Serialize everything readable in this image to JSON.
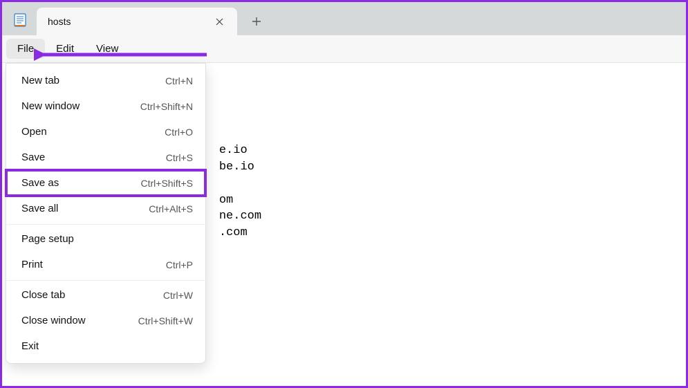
{
  "tab": {
    "title": "hosts"
  },
  "menubar": [
    "File",
    "Edit",
    "View"
  ],
  "dropdown": {
    "items": [
      {
        "label": "New tab",
        "shortcut": "Ctrl+N"
      },
      {
        "label": "New window",
        "shortcut": "Ctrl+Shift+N"
      },
      {
        "label": "Open",
        "shortcut": "Ctrl+O"
      },
      {
        "label": "Save",
        "shortcut": "Ctrl+S"
      },
      {
        "label": "Save as",
        "shortcut": "Ctrl+Shift+S"
      },
      {
        "label": "Save all",
        "shortcut": "Ctrl+Alt+S"
      },
      {
        "label": "Page setup",
        "shortcut": ""
      },
      {
        "label": "Print",
        "shortcut": "Ctrl+P"
      },
      {
        "label": "Close tab",
        "shortcut": "Ctrl+W"
      },
      {
        "label": "Close window",
        "shortcut": "Ctrl+Shift+W"
      },
      {
        "label": "Exit",
        "shortcut": ""
      }
    ]
  },
  "editor": {
    "lines": [
      "",
      "",
      "",
      "",
      "e.io",
      "be.io",
      "",
      "om",
      "ne.com",
      ".com"
    ]
  },
  "annotation": {
    "color": "#8a2be2"
  }
}
